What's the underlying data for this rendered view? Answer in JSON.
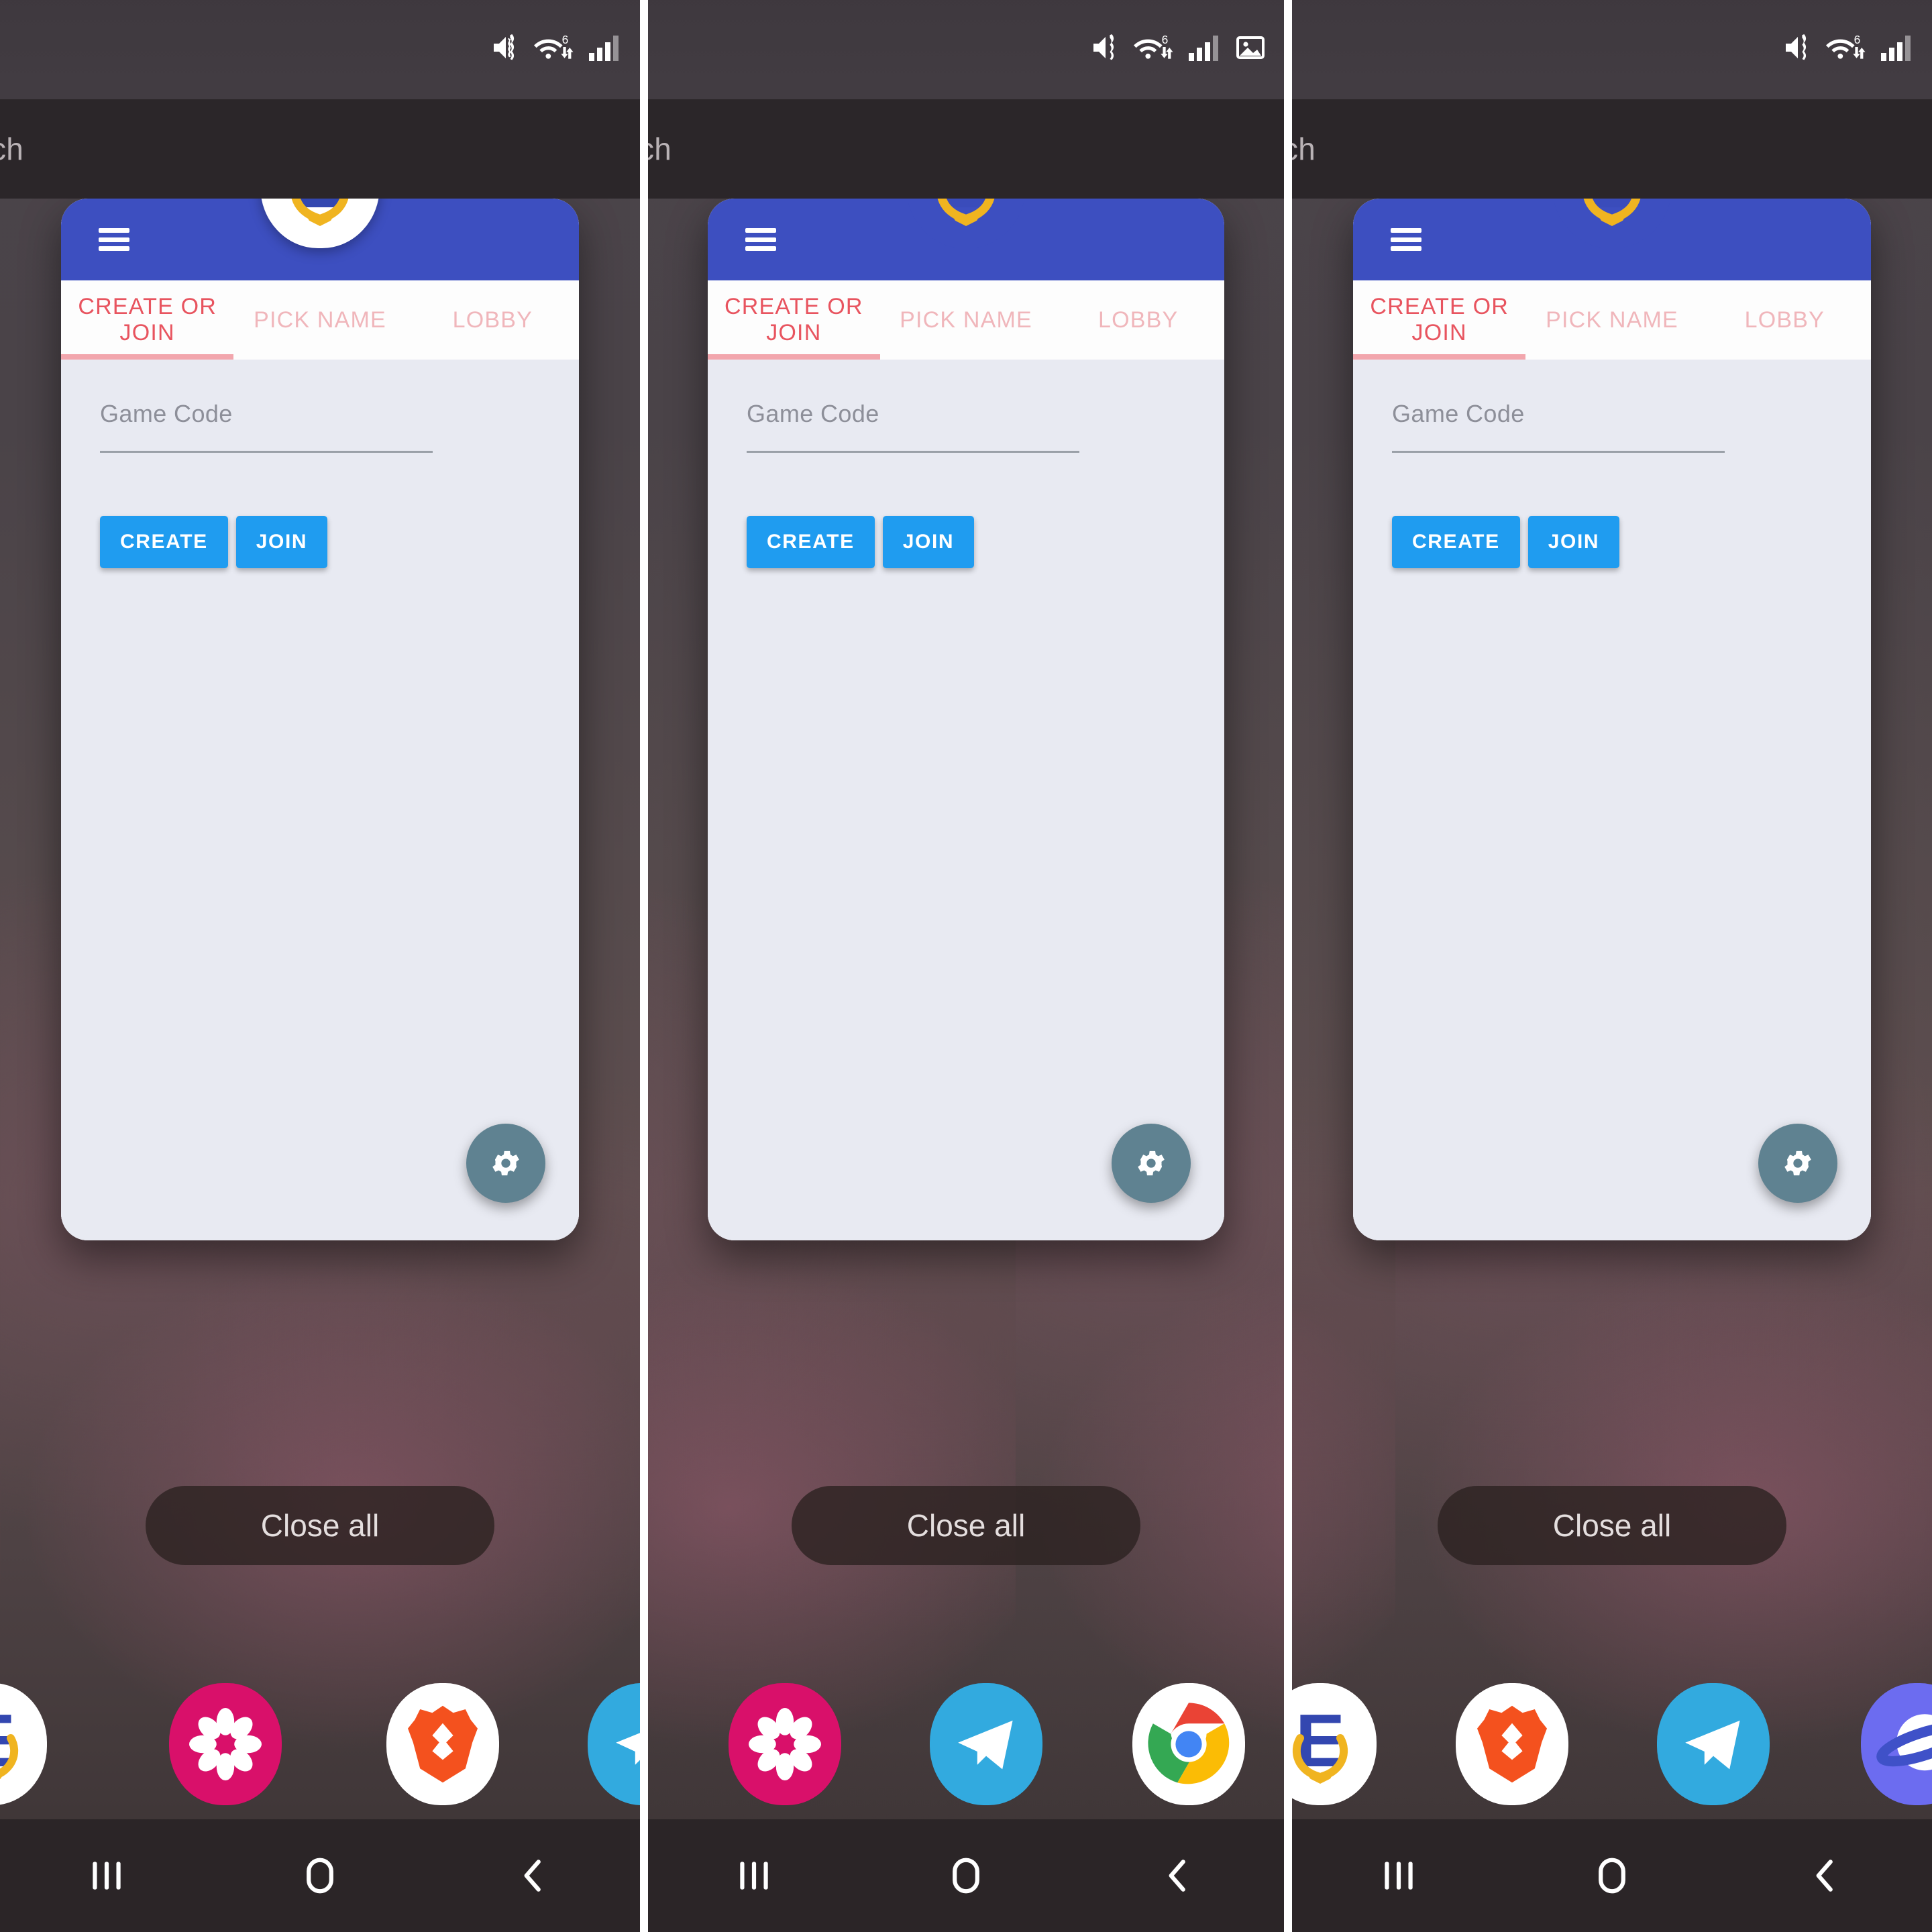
{
  "screen": {
    "device": "android-recents",
    "wallpaper_tone": "#4e4244"
  },
  "statusbar": {
    "icons": [
      "mute-vibrate-icon",
      "wifi-6-icon",
      "signal-bars-icon"
    ],
    "extra_icon_panel2": "image-gallery-icon"
  },
  "app_switcher": {
    "search_label_partial": "ch",
    "close_all_label": "Close all"
  },
  "app": {
    "name_icon": "e-laurel-icon",
    "appbar": {
      "menu_icon": "hamburger-menu-icon",
      "color": "#3d4fc0"
    },
    "tabs": [
      {
        "label": "CREATE OR JOIN",
        "active": true
      },
      {
        "label": "PICK NAME",
        "active": false
      },
      {
        "label": "LOBBY",
        "active": false
      }
    ],
    "tab_active_color": "#e8545f",
    "tab_inactive_color": "#f0b6bb",
    "form": {
      "game_code_label": "Game Code",
      "game_code_value": "",
      "game_code_placeholder": "Game Code"
    },
    "buttons": {
      "create": "CREATE",
      "join": "JOIN",
      "color": "#1f9cf0"
    },
    "fab": {
      "icon": "gear-icon",
      "color": "#5f8291"
    }
  },
  "cards": [
    {
      "id": "card-1",
      "icon_style": "white"
    },
    {
      "id": "card-2",
      "icon_style": "blue"
    },
    {
      "id": "card-3",
      "icon_style": "blue"
    }
  ],
  "dock": {
    "panel1": [
      {
        "name": "e-laurel-icon",
        "bg": "#ffffff"
      },
      {
        "name": "gallery-flower-icon",
        "bg": "#d9106a"
      },
      {
        "name": "brave-lion-icon",
        "bg": "#ffffff"
      },
      {
        "name": "telegram-icon",
        "bg": "#32aadf"
      }
    ],
    "panel2": [
      {
        "name": "gallery-flower-icon",
        "bg": "#d9106a"
      },
      {
        "name": "telegram-icon",
        "bg": "#32aadf"
      },
      {
        "name": "chrome-icon",
        "bg": "#ffffff"
      }
    ],
    "panel3": [
      {
        "name": "e-laurel-icon",
        "bg": "#ffffff"
      },
      {
        "name": "brave-lion-icon",
        "bg": "#ffffff"
      },
      {
        "name": "telegram-icon",
        "bg": "#32aadf"
      },
      {
        "name": "saturn-purple-icon",
        "bg": "#6c6cf0"
      }
    ]
  },
  "navbar": {
    "recents_icon": "recents-icon",
    "home_icon": "home-icon",
    "back_icon": "back-icon"
  }
}
